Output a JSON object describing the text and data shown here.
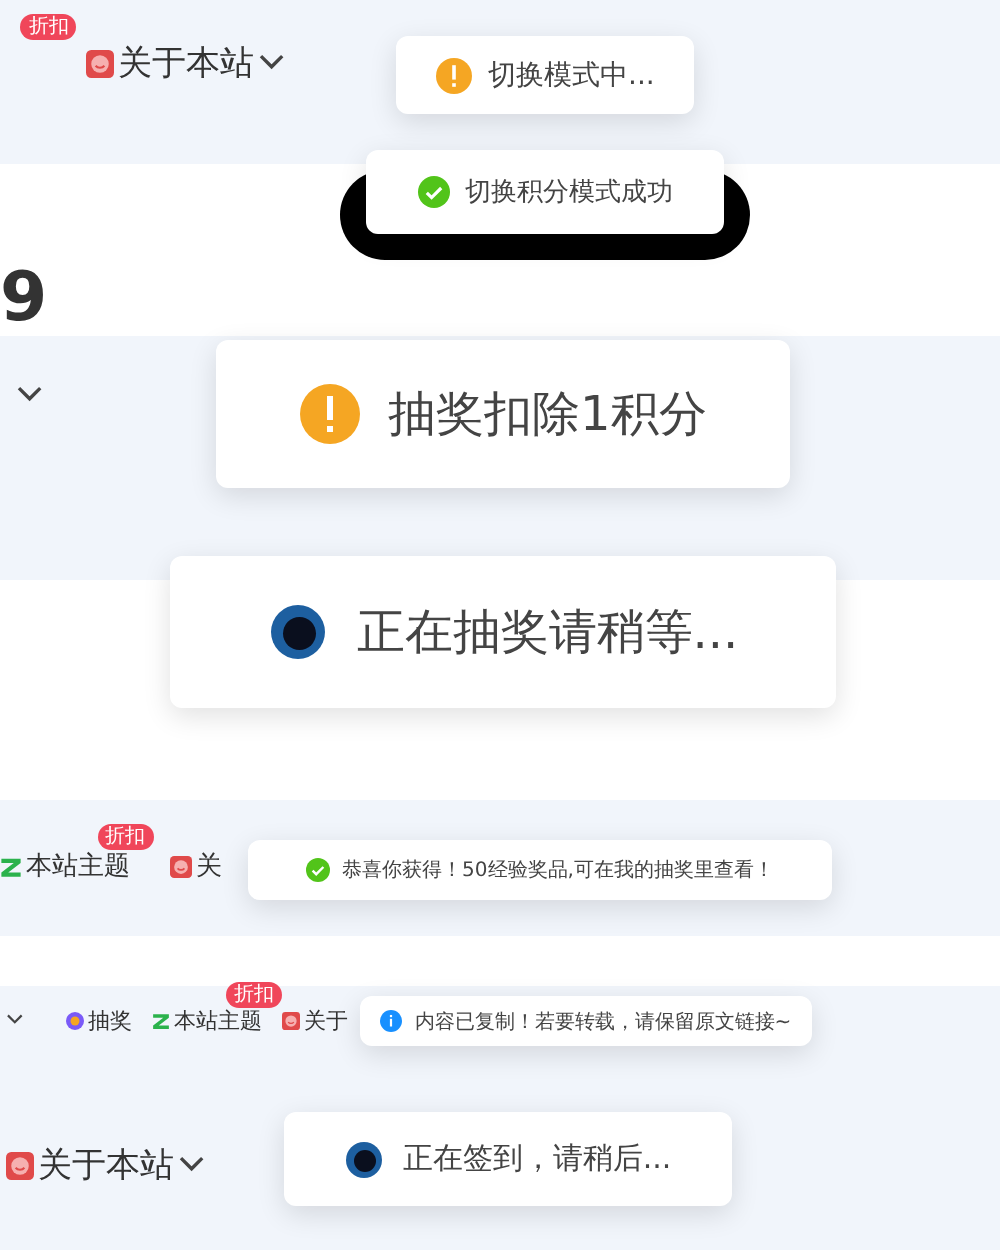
{
  "sections": [
    {
      "kind": "tinted",
      "rows": [
        [
          {
            "badge": "折扣"
          },
          {
            "kind": "about",
            "label": "关于本站",
            "caret": true
          }
        ]
      ],
      "toasts": [
        {
          "kind": "warning",
          "text": "切换模式中..."
        }
      ]
    },
    {
      "kind": "plain",
      "heading": "9",
      "toasts": [
        {
          "kind": "success",
          "text": "切换积分模式成功"
        }
      ]
    },
    {
      "kind": "tinted",
      "rows": [
        [
          {
            "caret": true
          }
        ]
      ],
      "toasts": [
        {
          "kind": "warning",
          "text": "抽奖扣除1积分"
        }
      ]
    },
    {
      "kind": "plain",
      "toasts": [
        {
          "kind": "loading",
          "text": "正在抽奖请稍等..."
        }
      ]
    },
    {
      "kind": "tinted",
      "rows": [
        [
          {
            "kind": "theme",
            "label": "本站主题",
            "badge": "折扣"
          },
          {
            "kind": "about",
            "label": "关"
          }
        ]
      ],
      "toasts": [
        {
          "kind": "success",
          "text": "恭喜你获得！50经验奖品,可在我的抽奖里查看！"
        }
      ]
    },
    {
      "kind": "plain"
    },
    {
      "kind": "tinted",
      "rows": [
        [
          {
            "caret": true
          },
          {
            "kind": "lottery",
            "label": "抽奖"
          },
          {
            "kind": "theme",
            "label": "本站主题",
            "badge": "折扣"
          },
          {
            "kind": "about",
            "label": "关于"
          }
        ],
        [
          {
            "kind": "about",
            "label": "关于本站",
            "caret": true
          }
        ]
      ],
      "toasts": [
        {
          "kind": "info",
          "text": "内容已复制！若要转载，请保留原文链接~"
        },
        {
          "kind": "loading",
          "text": "正在签到，请稍后..."
        }
      ]
    }
  ]
}
